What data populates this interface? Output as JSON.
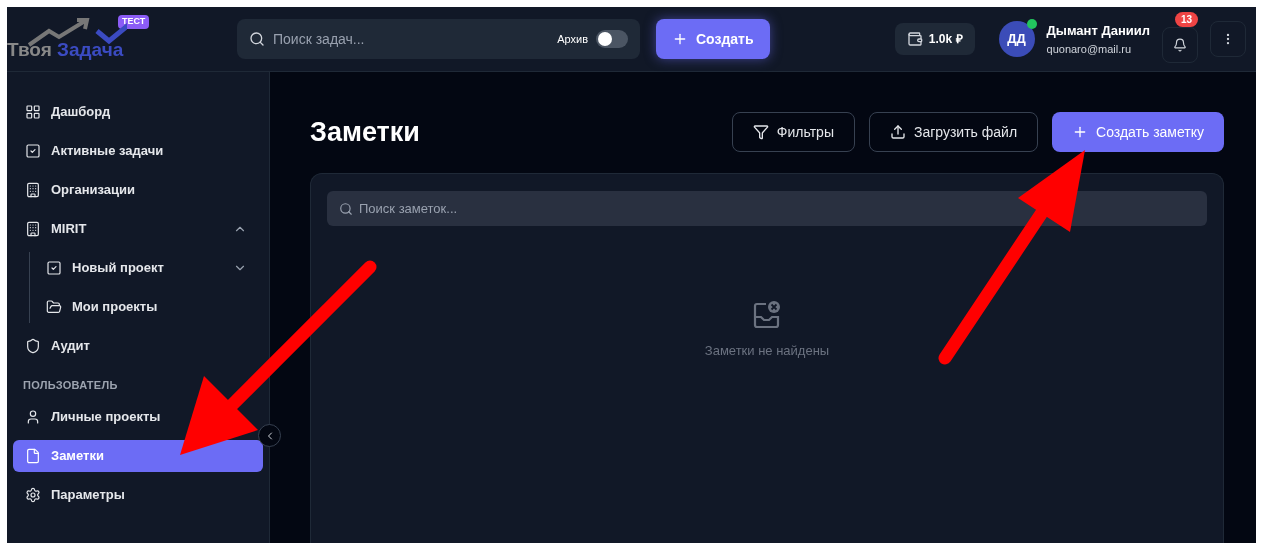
{
  "header": {
    "logo": {
      "word1": "Твоя",
      "word2": "Задача",
      "badge": "ТЕСТ"
    },
    "search": {
      "placeholder": "Поиск задач..."
    },
    "archive": {
      "label": "Архив",
      "on": false
    },
    "create_button": "Создать",
    "balance": "1.0k ₽",
    "user": {
      "initials": "ДД",
      "online": true,
      "name": "Дымант Даниил",
      "email": "quonaro@mail.ru"
    },
    "notifications": {
      "count": "13"
    }
  },
  "sidebar": {
    "items": [
      {
        "kind": "item",
        "label": "Дашборд",
        "selected": false
      },
      {
        "kind": "item",
        "label": "Активные задачи",
        "selected": false
      },
      {
        "kind": "item",
        "label": "Организации",
        "selected": false
      },
      {
        "kind": "group",
        "label": "MIRIT",
        "selected": false,
        "expanded": true,
        "children": [
          {
            "label": "Новый проект",
            "selected": false,
            "expanded": false
          },
          {
            "label": "Мои проекты",
            "selected": false
          }
        ]
      },
      {
        "kind": "item",
        "label": "Аудит",
        "selected": false
      },
      {
        "kind": "section",
        "label": "ПОЛЬЗОВАТЕЛЬ"
      },
      {
        "kind": "item",
        "label": "Личные проекты",
        "selected": false
      },
      {
        "kind": "item",
        "label": "Заметки",
        "selected": true
      },
      {
        "kind": "item",
        "label": "Параметры",
        "selected": false
      }
    ]
  },
  "page": {
    "title": "Заметки",
    "buttons": [
      {
        "kind": "filter",
        "label": "Фильтры"
      },
      {
        "kind": "upload",
        "label": "Загрузить файл"
      },
      {
        "kind": "primary",
        "label": "Создать заметку"
      }
    ],
    "search": {
      "placeholder": "Поиск заметок..."
    },
    "empty_message": "Заметки не найдены"
  }
}
